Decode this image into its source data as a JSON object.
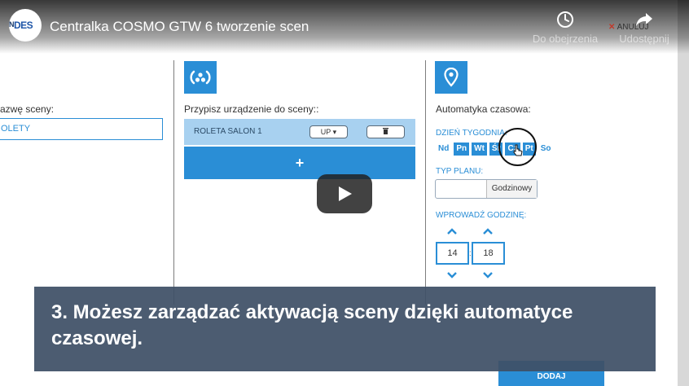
{
  "video": {
    "channel_logo_text": "DES",
    "channel_logo_left_text": "EN",
    "title": "Centralka COSMO GTW 6 tworzenie scen",
    "watch_later_label": "Do obejrzenia",
    "share_label": "Udostępnij",
    "caption": "3. Możesz zarządzać aktywacją sceny dzięki automatyce czasowej."
  },
  "scene_form": {
    "name_label": "azwę sceny:",
    "name_value": "OLETY"
  },
  "devices": {
    "label": "Przypisz urządzenie do sceny::",
    "items": [
      {
        "name": "ROLETA SALON 1",
        "action": "UP"
      }
    ],
    "add_label": "+"
  },
  "automation": {
    "label": "Automatyka czasowa:",
    "cancel_label": "ANULUJ",
    "days_label": "DZIEŃ TYGODNIA:",
    "days": [
      {
        "label": "Nd",
        "active": false
      },
      {
        "label": "Pn",
        "active": true
      },
      {
        "label": "Wt",
        "active": true
      },
      {
        "label": "Śr",
        "active": true
      },
      {
        "label": "Cz",
        "active": true
      },
      {
        "label": "Pt",
        "active": true
      },
      {
        "label": "So",
        "active": false
      }
    ],
    "plan_type_label": "TYP PLANU:",
    "plan_type_value": "Godzinowy",
    "time_label": "WPROWADŹ GODZINĘ:",
    "hour": "14",
    "time_separator": ":",
    "minute": "18",
    "submit_label": "DODAJ"
  },
  "colors": {
    "accent": "#2a8ed6",
    "device_row": "#a8d1f0",
    "caption_bg": "#3e5066"
  }
}
